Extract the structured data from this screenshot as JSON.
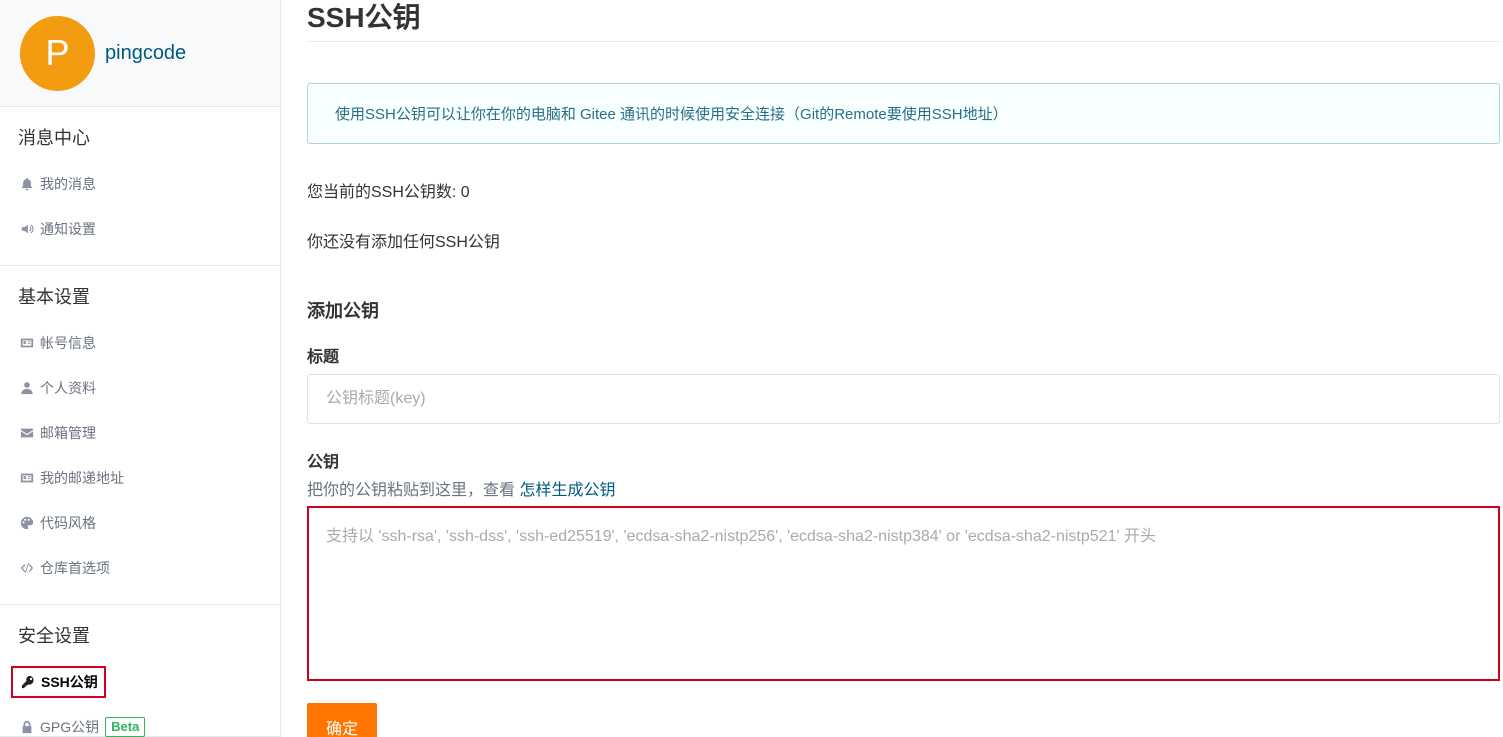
{
  "profile": {
    "avatar_letter": "P",
    "username": "pingcode"
  },
  "sidebar": {
    "sections": [
      {
        "title": "消息中心",
        "items": [
          {
            "label": "我的消息",
            "icon": "bell-icon"
          },
          {
            "label": "通知设置",
            "icon": "speaker-icon"
          }
        ]
      },
      {
        "title": "基本设置",
        "items": [
          {
            "label": "帐号信息",
            "icon": "id-card-icon"
          },
          {
            "label": "个人资料",
            "icon": "user-icon"
          },
          {
            "label": "邮箱管理",
            "icon": "envelope-icon"
          },
          {
            "label": "我的邮递地址",
            "icon": "address-card-icon"
          },
          {
            "label": "代码风格",
            "icon": "palette-icon"
          },
          {
            "label": "仓库首选项",
            "icon": "code-icon"
          }
        ]
      },
      {
        "title": "安全设置",
        "items": [
          {
            "label": "SSH公钥",
            "icon": "key-icon",
            "active": true
          },
          {
            "label": "GPG公钥",
            "icon": "lock-icon",
            "badge": "Beta"
          }
        ]
      }
    ]
  },
  "main": {
    "title": "SSH公钥",
    "info": "使用SSH公钥可以让你在你的电脑和 Gitee 通讯的时候使用安全连接（Git的Remote要使用SSH地址）",
    "count_text": "您当前的SSH公钥数: 0",
    "empty_text": "你还没有添加任何SSH公钥",
    "add_title": "添加公钥",
    "title_label": "标题",
    "title_placeholder": "公钥标题(key)",
    "key_label": "公钥",
    "key_hint_prefix": "把你的公钥粘贴到这里，查看 ",
    "key_hint_link": "怎样生成公钥",
    "key_placeholder": "支持以 'ssh-rsa', 'ssh-dss', 'ssh-ed25519', 'ecdsa-sha2-nistp256', 'ecdsa-sha2-nistp384' or 'ecdsa-sha2-nistp521' 开头",
    "submit_label": "确定"
  },
  "colors": {
    "accent": "#ff7500",
    "avatar": "#f39c12",
    "highlight": "#d0021b",
    "beta": "#2fb55e",
    "info_text": "#276f86"
  }
}
